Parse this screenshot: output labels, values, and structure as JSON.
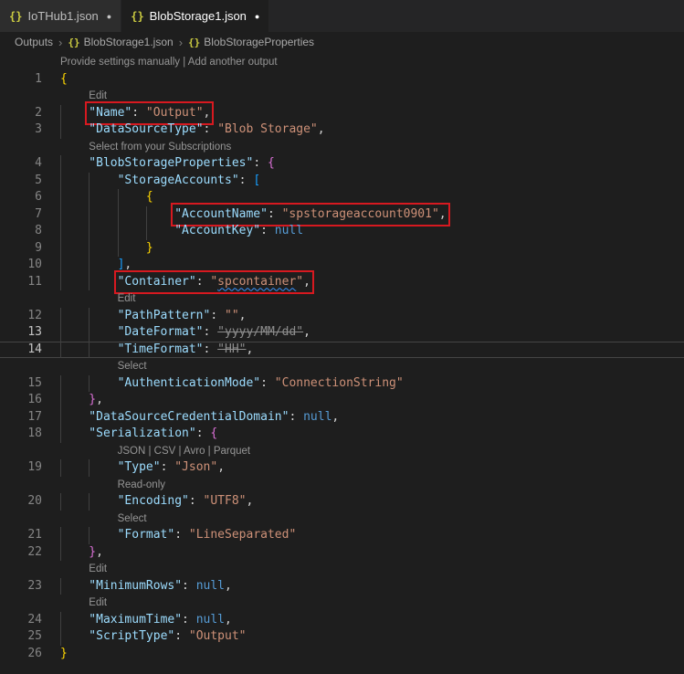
{
  "icons": {
    "json_braces": "{}",
    "modified_dot": "●",
    "crumb_sep": "›"
  },
  "tabs": [
    {
      "label": "IoTHub1.json",
      "modified": true,
      "active": false
    },
    {
      "label": "BlobStorage1.json",
      "modified": true,
      "active": true
    }
  ],
  "breadcrumb": [
    {
      "label": "Outputs"
    },
    {
      "label": "BlobStorage1.json",
      "icon": "json-braces"
    },
    {
      "label": "BlobStorageProperties",
      "icon": "json-braces"
    }
  ],
  "colors": {
    "bg": "#1e1e1e",
    "tabBar": "#252526",
    "tabInactive": "#2d2d2d",
    "tabActive": "#1e1e1e",
    "tabText": "#bdbdbd",
    "tabTextActive": "#ffffff",
    "jsonIcon": "#cbcb41",
    "crumb": "#a9a9a9",
    "crumbSep": "#7a7a7a",
    "num": "#858585",
    "numActive": "#c6c6c6",
    "key": "#9cdcfe",
    "str": "#ce9178",
    "kw": "#569cd6",
    "punct": "#d4d4d4",
    "b1": "#ffd700",
    "b2": "#da70d6",
    "b3": "#179fff",
    "lens": "#969696",
    "guide": "#404040",
    "strike": "#8e8e8e",
    "squiggle": "#3794ff",
    "annotation": "#d71920",
    "currentLine": "#454545"
  },
  "editor": {
    "rows": [
      {
        "t": "lens",
        "indent": 0,
        "text": "Provide settings manually | Add another output"
      },
      {
        "t": "code",
        "n": 1,
        "indent": 0,
        "tokens": [
          [
            "b1",
            "{"
          ]
        ]
      },
      {
        "t": "lens",
        "indent": 1,
        "text": "Edit"
      },
      {
        "t": "code",
        "n": 2,
        "indent": 1,
        "box": true,
        "tokens": [
          [
            "key",
            "\"Name\""
          ],
          [
            "punct",
            ": "
          ],
          [
            "str",
            "\"Output\""
          ],
          [
            "punct",
            ","
          ]
        ]
      },
      {
        "t": "code",
        "n": 3,
        "indent": 1,
        "tokens": [
          [
            "key",
            "\"DataSourceType\""
          ],
          [
            "punct",
            ": "
          ],
          [
            "str",
            "\"Blob Storage\""
          ],
          [
            "punct",
            ","
          ]
        ]
      },
      {
        "t": "lens",
        "indent": 1,
        "text": "Select from your Subscriptions"
      },
      {
        "t": "code",
        "n": 4,
        "indent": 1,
        "tokens": [
          [
            "key",
            "\"BlobStorageProperties\""
          ],
          [
            "punct",
            ": "
          ],
          [
            "b2",
            "{"
          ]
        ]
      },
      {
        "t": "code",
        "n": 5,
        "indent": 2,
        "tokens": [
          [
            "key",
            "\"StorageAccounts\""
          ],
          [
            "punct",
            ": "
          ],
          [
            "b3",
            "["
          ]
        ]
      },
      {
        "t": "code",
        "n": 6,
        "indent": 3,
        "tokens": [
          [
            "b1",
            "{"
          ]
        ]
      },
      {
        "t": "code",
        "n": 7,
        "indent": 4,
        "box": true,
        "tokens": [
          [
            "key",
            "\"AccountName\""
          ],
          [
            "punct",
            ": "
          ],
          [
            "str",
            "\"spstorageaccount0901\""
          ],
          [
            "punct",
            ","
          ]
        ]
      },
      {
        "t": "code",
        "n": 8,
        "indent": 4,
        "tokens": [
          [
            "key",
            "\"AccountKey\""
          ],
          [
            "punct",
            ": "
          ],
          [
            "kw",
            "null"
          ]
        ]
      },
      {
        "t": "code",
        "n": 9,
        "indent": 3,
        "tokens": [
          [
            "b1",
            "}"
          ]
        ]
      },
      {
        "t": "code",
        "n": 10,
        "indent": 2,
        "tokens": [
          [
            "b3",
            "]"
          ],
          [
            "punct",
            ","
          ]
        ]
      },
      {
        "t": "code",
        "n": 11,
        "indent": 2,
        "box": true,
        "tokens": [
          [
            "key",
            "\"Container\""
          ],
          [
            "punct",
            ": "
          ],
          [
            "str",
            "\""
          ],
          [
            "squig",
            "spcontainer"
          ],
          [
            "str",
            "\""
          ],
          [
            "punct",
            ","
          ]
        ]
      },
      {
        "t": "lens",
        "indent": 2,
        "text": "Edit"
      },
      {
        "t": "code",
        "n": 12,
        "indent": 2,
        "tokens": [
          [
            "key",
            "\"PathPattern\""
          ],
          [
            "punct",
            ": "
          ],
          [
            "str",
            "\"\""
          ],
          [
            "punct",
            ","
          ]
        ]
      },
      {
        "t": "code",
        "n": 13,
        "indent": 2,
        "bright": true,
        "tokens": [
          [
            "key",
            "\"DateFormat\""
          ],
          [
            "punct",
            ": "
          ],
          [
            "strike",
            "\"yyyy/MM/dd\""
          ],
          [
            "punct",
            ","
          ]
        ]
      },
      {
        "t": "code",
        "n": 14,
        "indent": 2,
        "bright": true,
        "current": true,
        "tokens": [
          [
            "key",
            "\"TimeFormat\""
          ],
          [
            "punct",
            ": "
          ],
          [
            "strike",
            "\"HH\""
          ],
          [
            "punct",
            ","
          ]
        ]
      },
      {
        "t": "lens",
        "indent": 2,
        "text": "Select"
      },
      {
        "t": "code",
        "n": 15,
        "indent": 2,
        "tokens": [
          [
            "key",
            "\"AuthenticationMode\""
          ],
          [
            "punct",
            ": "
          ],
          [
            "str",
            "\"ConnectionString\""
          ]
        ]
      },
      {
        "t": "code",
        "n": 16,
        "indent": 1,
        "tokens": [
          [
            "b2",
            "}"
          ],
          [
            "punct",
            ","
          ]
        ]
      },
      {
        "t": "code",
        "n": 17,
        "indent": 1,
        "tokens": [
          [
            "key",
            "\"DataSourceCredentialDomain\""
          ],
          [
            "punct",
            ": "
          ],
          [
            "kw",
            "null"
          ],
          [
            "punct",
            ","
          ]
        ]
      },
      {
        "t": "code",
        "n": 18,
        "indent": 1,
        "tokens": [
          [
            "key",
            "\"Serialization\""
          ],
          [
            "punct",
            ": "
          ],
          [
            "b2",
            "{"
          ]
        ]
      },
      {
        "t": "lens",
        "indent": 2,
        "text": "JSON | CSV | Avro | Parquet"
      },
      {
        "t": "code",
        "n": 19,
        "indent": 2,
        "tokens": [
          [
            "key",
            "\"Type\""
          ],
          [
            "punct",
            ": "
          ],
          [
            "str",
            "\"Json\""
          ],
          [
            "punct",
            ","
          ]
        ]
      },
      {
        "t": "lens",
        "indent": 2,
        "text": "Read-only"
      },
      {
        "t": "code",
        "n": 20,
        "indent": 2,
        "tokens": [
          [
            "key",
            "\"Encoding\""
          ],
          [
            "punct",
            ": "
          ],
          [
            "str",
            "\"UTF8\""
          ],
          [
            "punct",
            ","
          ]
        ]
      },
      {
        "t": "lens",
        "indent": 2,
        "text": "Select"
      },
      {
        "t": "code",
        "n": 21,
        "indent": 2,
        "tokens": [
          [
            "key",
            "\"Format\""
          ],
          [
            "punct",
            ": "
          ],
          [
            "str",
            "\"LineSeparated\""
          ]
        ]
      },
      {
        "t": "code",
        "n": 22,
        "indent": 1,
        "tokens": [
          [
            "b2",
            "}"
          ],
          [
            "punct",
            ","
          ]
        ]
      },
      {
        "t": "lens",
        "indent": 1,
        "text": "Edit"
      },
      {
        "t": "code",
        "n": 23,
        "indent": 1,
        "tokens": [
          [
            "key",
            "\"MinimumRows\""
          ],
          [
            "punct",
            ": "
          ],
          [
            "kw",
            "null"
          ],
          [
            "punct",
            ","
          ]
        ]
      },
      {
        "t": "lens",
        "indent": 1,
        "text": "Edit"
      },
      {
        "t": "code",
        "n": 24,
        "indent": 1,
        "tokens": [
          [
            "key",
            "\"MaximumTime\""
          ],
          [
            "punct",
            ": "
          ],
          [
            "kw",
            "null"
          ],
          [
            "punct",
            ","
          ]
        ]
      },
      {
        "t": "code",
        "n": 25,
        "indent": 1,
        "tokens": [
          [
            "key",
            "\"ScriptType\""
          ],
          [
            "punct",
            ": "
          ],
          [
            "str",
            "\"Output\""
          ]
        ]
      },
      {
        "t": "code",
        "n": 26,
        "indent": 0,
        "tokens": [
          [
            "b1",
            "}"
          ]
        ]
      }
    ]
  }
}
